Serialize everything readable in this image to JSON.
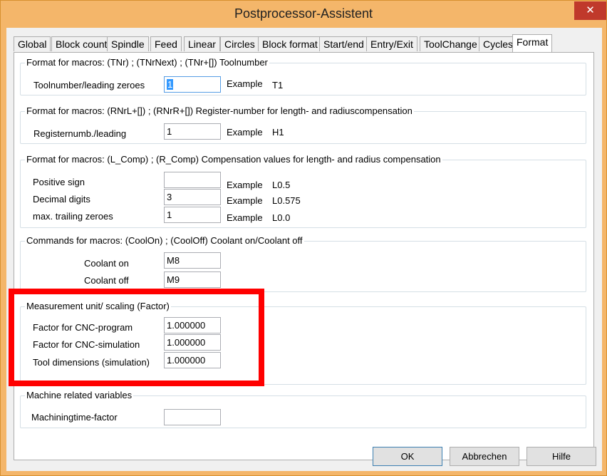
{
  "window": {
    "title": "Postprocessor-Assistent",
    "close": "✕"
  },
  "tabs": [
    "Global",
    "Block count",
    "Spindle",
    "Feed",
    "Linear",
    "Circles",
    "Block format",
    "Start/end",
    "Entry/Exit",
    "ToolChange",
    "Cycles",
    "Format"
  ],
  "active_tab": "Format",
  "group_tool": {
    "title": "Format for macros:  (TNr) ; (TNrNext) ; (TNr+[])   Toolnumber",
    "label": "Toolnumber/leading zeroes",
    "value": "1",
    "example_label": "Example",
    "example_value": "T1"
  },
  "group_register": {
    "title": "Format for macros:  (RNrL+[]) ; (RNrR+[])   Register-number for length- and radiuscompensation",
    "label": "Registernumb./leading",
    "value": "1",
    "example_label": "Example",
    "example_value": "H1"
  },
  "group_comp": {
    "title": "Format for macros: (L_Comp)  ;  (R_Comp)    Compensation values for length- and radius compensation",
    "rows": [
      {
        "label": "Positive sign",
        "value": "",
        "example_label": "Example",
        "example_value": "L0.5"
      },
      {
        "label": "Decimal digits",
        "value": "3",
        "example_label": "Example",
        "example_value": "L0.575"
      },
      {
        "label": "max. trailing zeroes",
        "value": "1",
        "example_label": "Example",
        "example_value": "L0.0"
      }
    ]
  },
  "group_coolant": {
    "title": "Commands for macros:  (CoolOn) ; (CoolOff)  Coolant on/Coolant off",
    "rows": [
      {
        "label": "Coolant on",
        "value": "M8"
      },
      {
        "label": "Coolant off",
        "value": "M9"
      }
    ]
  },
  "group_scaling": {
    "title": "Measurement unit/ scaling (Factor)",
    "rows": [
      {
        "label": "Factor for CNC-program",
        "value": "1.000000"
      },
      {
        "label": "Factor for CNC-simulation",
        "value": "1.000000"
      },
      {
        "label": "Tool dimensions (simulation)",
        "value": "1.000000"
      }
    ]
  },
  "group_machine": {
    "title": "Machine related variables",
    "label": "Machiningtime-factor",
    "value": ""
  },
  "buttons": {
    "ok": "OK",
    "cancel": "Abbrechen",
    "help": "Hilfe"
  },
  "colors": {
    "title_bg": "#f4b66a",
    "close_bg": "#c0392b",
    "highlight": "#ff0000",
    "selection": "#3399ff"
  }
}
